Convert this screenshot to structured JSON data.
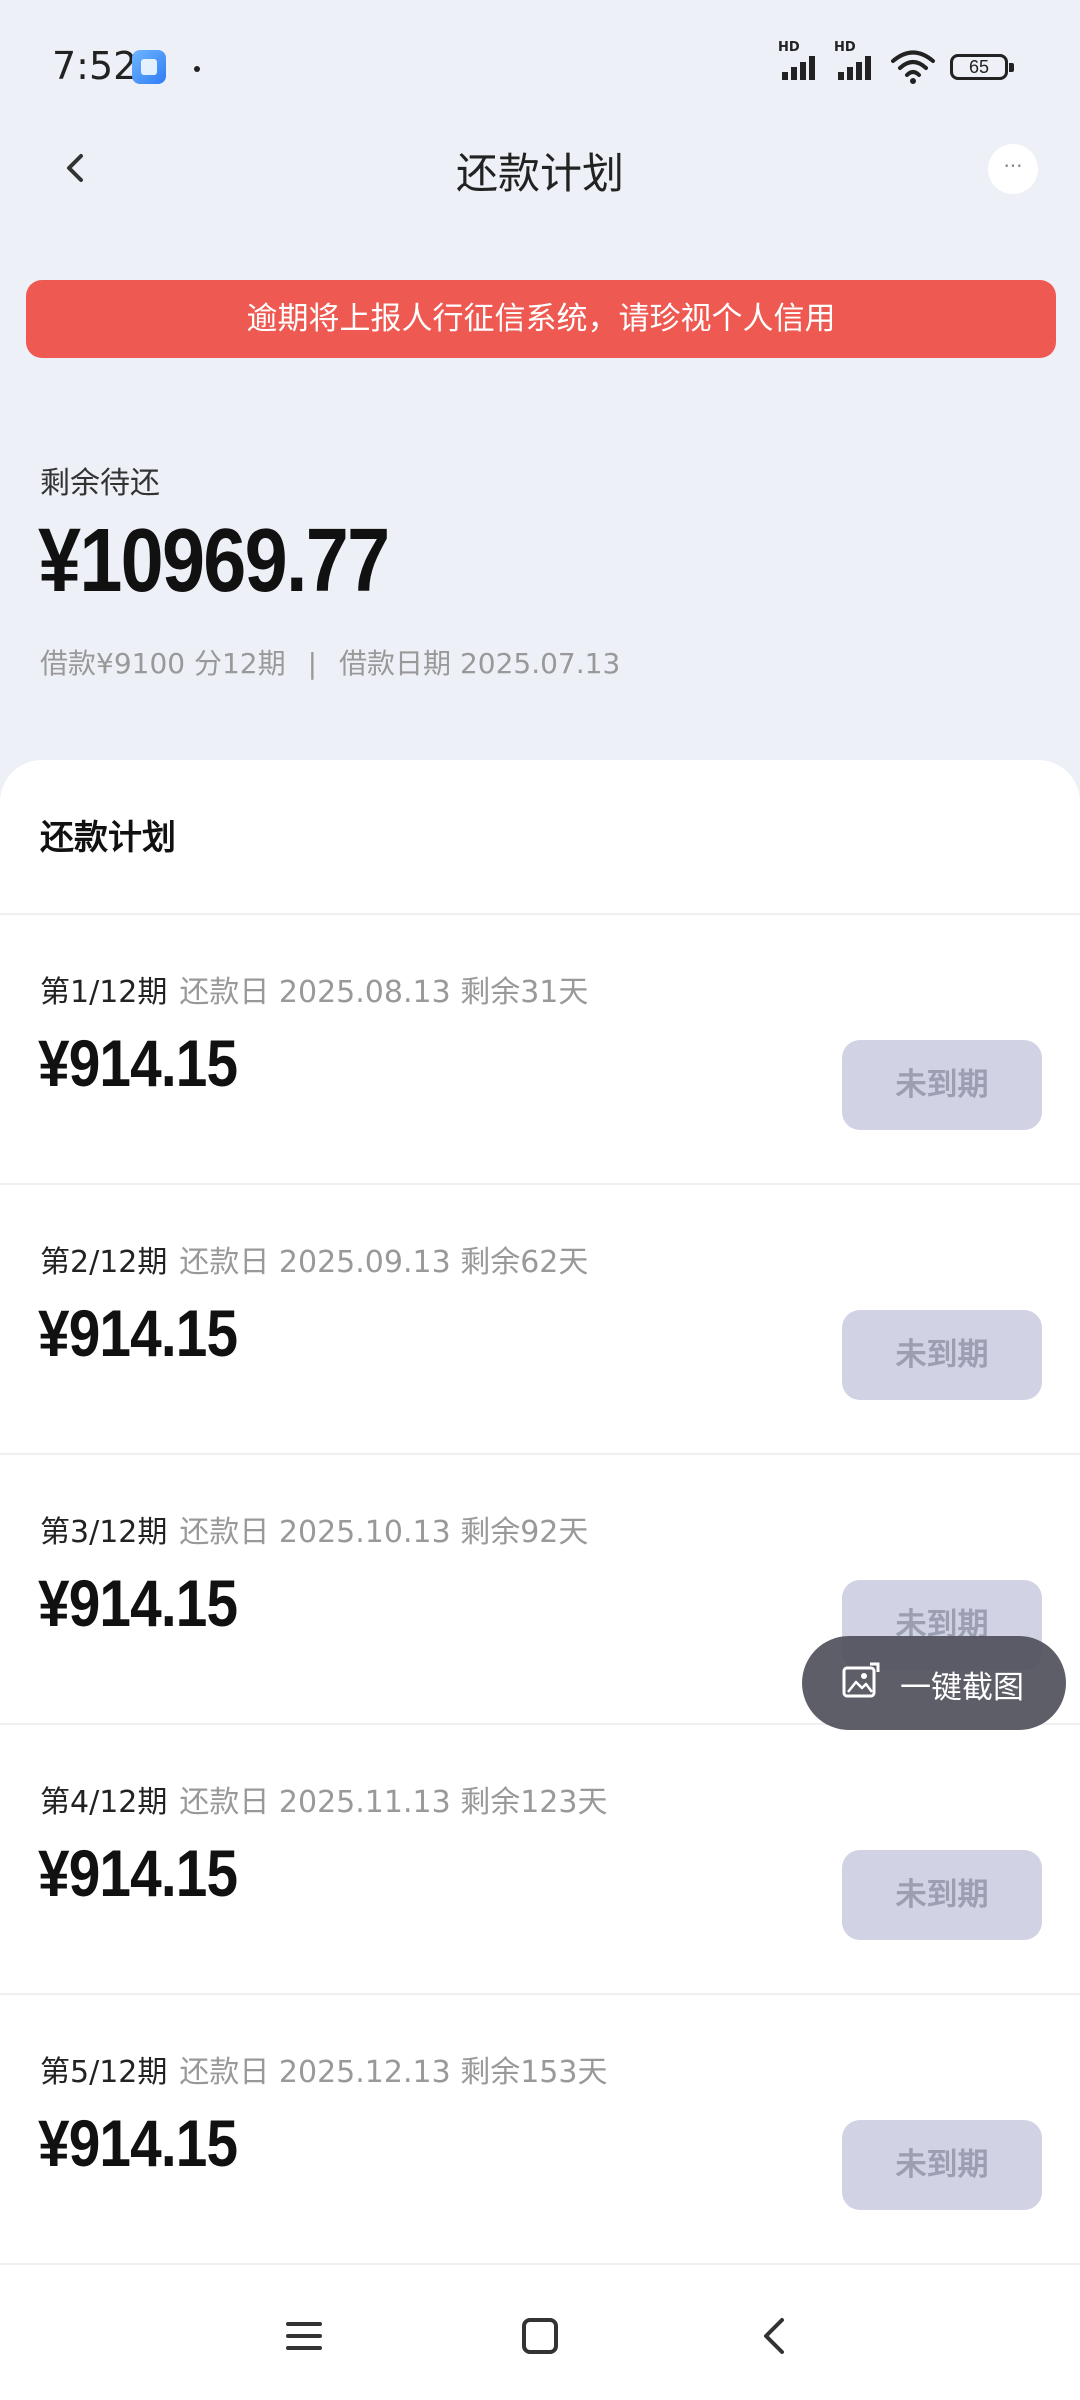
{
  "status_bar": {
    "time": "7:52",
    "signal1_label": "HD",
    "signal2_label": "HD",
    "battery": "65"
  },
  "header": {
    "title": "还款计划",
    "back_icon": "chevron-left-icon",
    "more_icon": "more-horizontal-icon",
    "more_label": "···"
  },
  "warning": {
    "text": "逾期将上报人行征信系统，请珍视个人信用",
    "color": "#ee5a52"
  },
  "summary": {
    "label": "剩余待还",
    "amount": "¥10969.77",
    "loan_text": "借款¥9100 分12期",
    "separator": "|",
    "date_text": "借款日期 2025.07.13"
  },
  "plan": {
    "title": "还款计划",
    "items": [
      {
        "period": "第1/12期",
        "meta": "还款日 2025.08.13 剩余31天",
        "amount": "¥914.15",
        "status": "未到期"
      },
      {
        "period": "第2/12期",
        "meta": "还款日 2025.09.13 剩余62天",
        "amount": "¥914.15",
        "status": "未到期"
      },
      {
        "period": "第3/12期",
        "meta": "还款日 2025.10.13 剩余92天",
        "amount": "¥914.15",
        "status": "未到期"
      },
      {
        "period": "第4/12期",
        "meta": "还款日 2025.11.13 剩余123天",
        "amount": "¥914.15",
        "status": "未到期"
      },
      {
        "period": "第5/12期",
        "meta": "还款日 2025.12.13 剩余153天",
        "amount": "¥914.15",
        "status": "未到期"
      }
    ]
  },
  "floating": {
    "label": "一键截图",
    "icon": "screenshot-icon"
  },
  "bottom_nav": {
    "menu_icon": "menu-icon",
    "home_icon": "home-square-icon",
    "back_icon": "back-triangle-icon"
  }
}
